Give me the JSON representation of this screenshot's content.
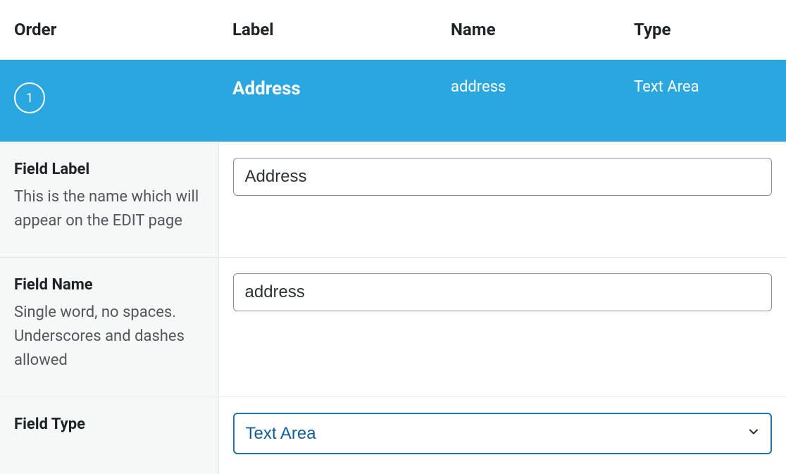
{
  "columns": {
    "order": "Order",
    "label": "Label",
    "name": "Name",
    "type": "Type"
  },
  "row": {
    "order": "1",
    "label": "Address",
    "name": "address",
    "type": "Text Area"
  },
  "settings": {
    "fieldLabel": {
      "title": "Field Label",
      "desc": "This is the name which will appear on the EDIT page",
      "value": "Address"
    },
    "fieldName": {
      "title": "Field Name",
      "desc": "Single word, no spaces. Underscores and dashes allowed",
      "value": "address"
    },
    "fieldType": {
      "title": "Field Type",
      "value": "Text Area"
    }
  }
}
